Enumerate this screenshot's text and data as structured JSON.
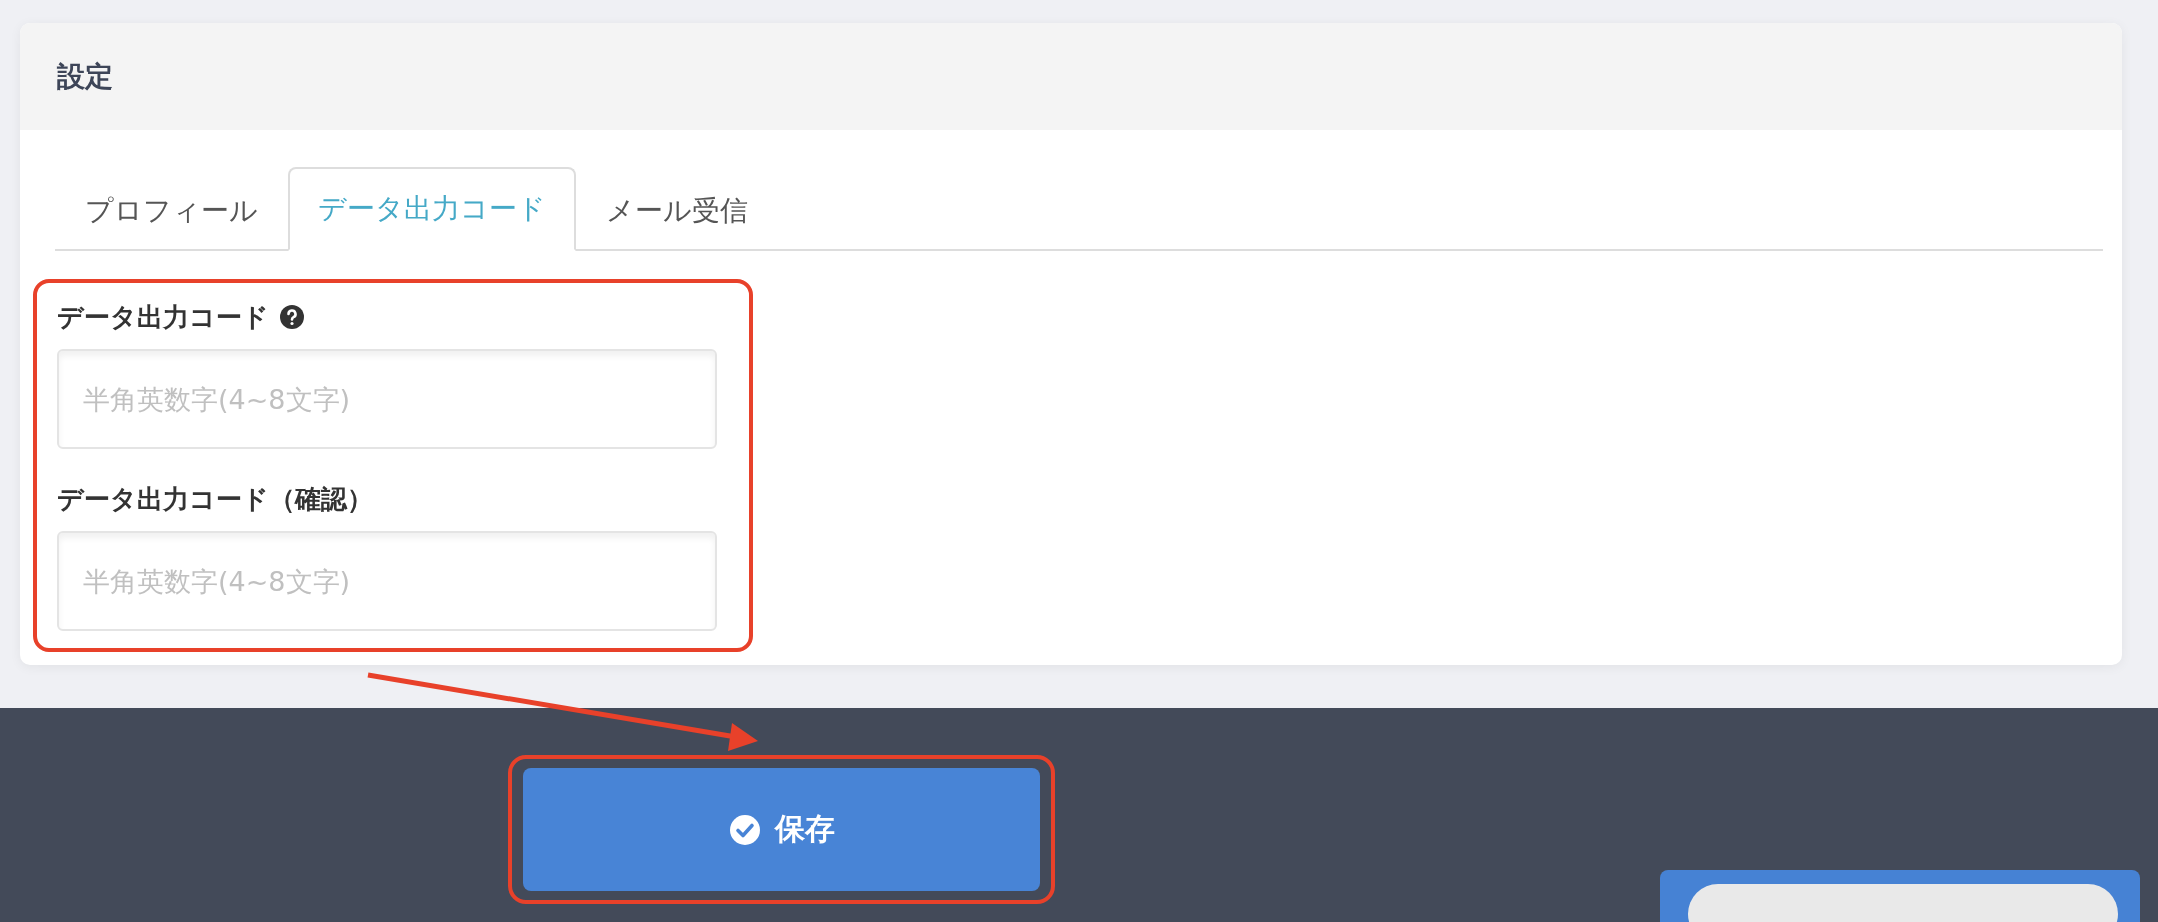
{
  "header": {
    "title": "設定"
  },
  "tabs": [
    {
      "label": "プロフィール",
      "selected": false
    },
    {
      "label": "データ出力コード",
      "selected": true
    },
    {
      "label": "メール受信",
      "selected": false
    }
  ],
  "fields": [
    {
      "label": "データ出力コード",
      "help": true,
      "placeholder": "半角英数字(4~8文字)"
    },
    {
      "label": "データ出力コード（確認）",
      "help": false,
      "placeholder": "半角英数字(4~8文字)"
    }
  ],
  "save_button": {
    "label": "保存"
  }
}
